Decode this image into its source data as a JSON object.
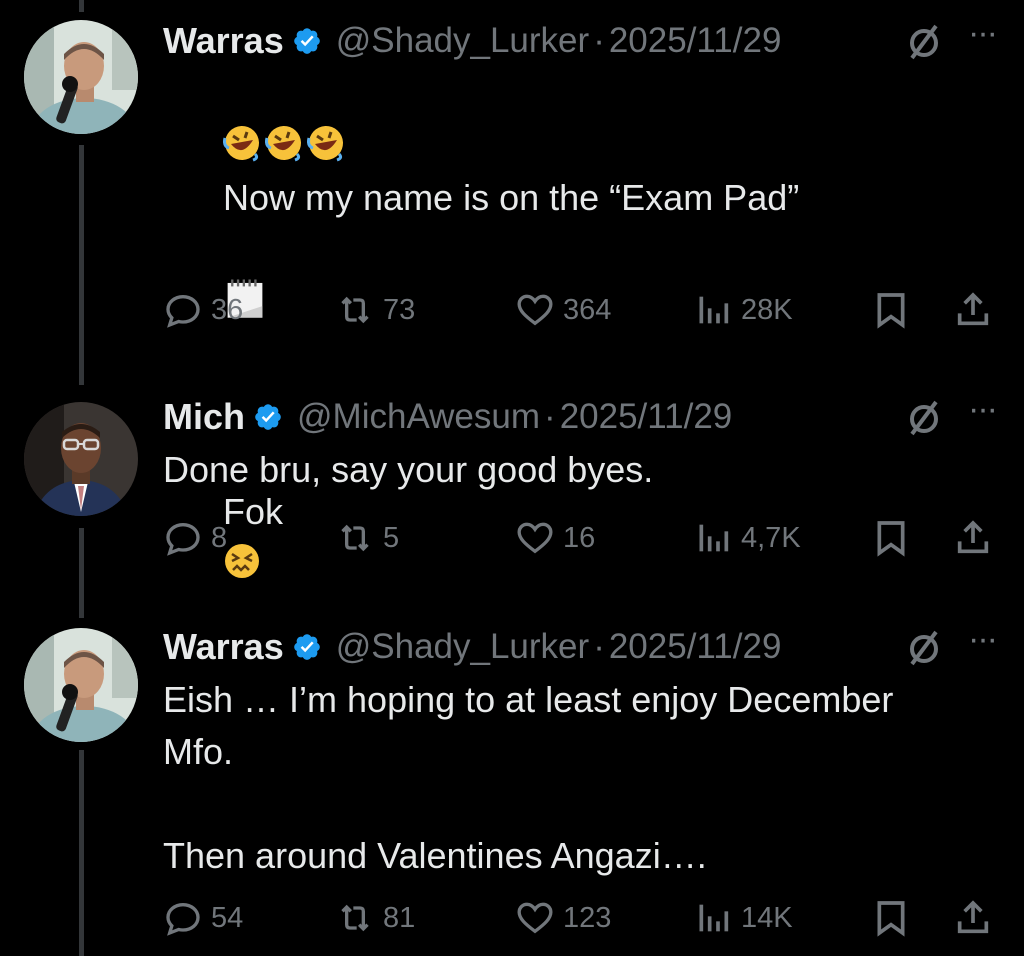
{
  "tweets": [
    {
      "name": "Warras",
      "handle": "@Shady_Lurker",
      "separator": "·",
      "date": "2025/11/29",
      "text_line1": "Now my name is on the “Exam Pad”",
      "text_line3": "Fok",
      "emojis": [
        "rolling-on-floor-laughing",
        "rolling-on-floor-laughing",
        "rolling-on-floor-laughing",
        "spiral-notepad",
        "confounded-face"
      ],
      "replies": "36",
      "retweets": "73",
      "likes": "364",
      "views": "28K"
    },
    {
      "name": "Mich",
      "handle": "@MichAwesum",
      "separator": "·",
      "date": "2025/11/29",
      "text": "Done bru, say your good byes.",
      "replies": "8",
      "retweets": "5",
      "likes": "16",
      "views": "4,7K"
    },
    {
      "name": "Warras",
      "handle": "@Shady_Lurker",
      "separator": "·",
      "date": "2025/11/29",
      "text": "Eish … I’m hoping to at least enjoy December\nMfo.\n\nThen around Valentines Angazi….",
      "replies": "54",
      "retweets": "81",
      "likes": "123",
      "views": "14K"
    }
  ],
  "icons": {
    "verified": "verified-badge-icon",
    "grok": "grok-icon",
    "more": "more-icon",
    "reply": "reply-icon",
    "retweet": "retweet-icon",
    "like": "heart-icon",
    "views": "views-chart-icon",
    "bookmark": "bookmark-icon",
    "share": "share-icon"
  },
  "colors": {
    "background": "#000000",
    "text": "#e7e9ea",
    "secondary": "#71767b",
    "verified": "#1d9bf0",
    "thread_line": "#333639"
  }
}
